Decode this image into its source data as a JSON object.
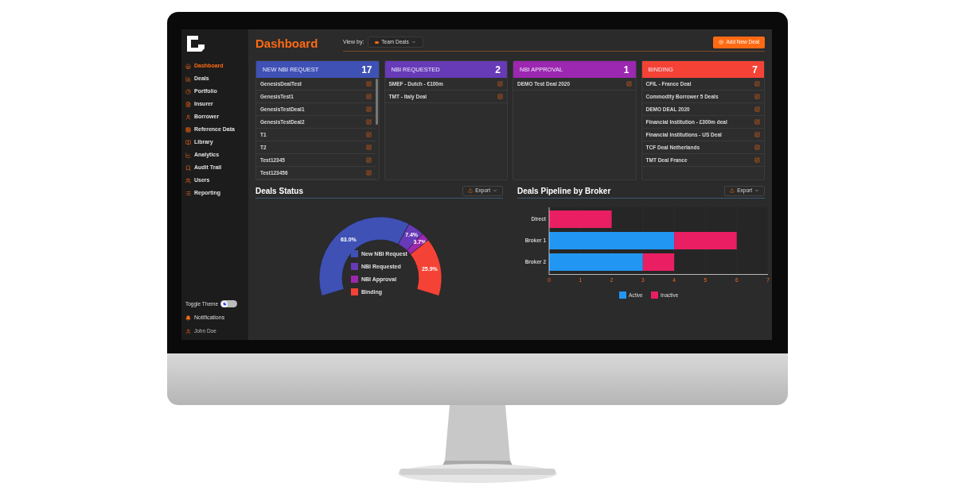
{
  "sidebar": {
    "items": [
      {
        "label": "Dashboard",
        "selected": true
      },
      {
        "label": "Deals",
        "selected": false
      },
      {
        "label": "Portfolio",
        "selected": false
      },
      {
        "label": "Insurer",
        "selected": false
      },
      {
        "label": "Borrower",
        "selected": false
      },
      {
        "label": "Reference Data",
        "selected": false
      },
      {
        "label": "Library",
        "selected": false
      },
      {
        "label": "Analytics",
        "selected": false
      },
      {
        "label": "Audit Trail",
        "selected": false
      },
      {
        "label": "Users",
        "selected": false
      },
      {
        "label": "Reporting",
        "selected": false
      }
    ],
    "toggle": {
      "label": "Toggle Theme",
      "on": false
    },
    "notifications": "Notifications",
    "user": "John Doe"
  },
  "header": {
    "title": "Dashboard",
    "view_by_label": "View by:",
    "view_by_value": "Team Deals",
    "add_button": "Add New Deal"
  },
  "columns": [
    {
      "title": "NEW NBI REQUEST",
      "count": "17",
      "color": "#3f51b5",
      "deals": [
        "GenesisDealTest",
        "GenesisTest1",
        "GenesisTestDeal1",
        "GenesisTestDeal2",
        "T1",
        "T2",
        "Test12345",
        "Test123456"
      ]
    },
    {
      "title": "NBI REQUESTED",
      "count": "2",
      "color": "#673ab7",
      "deals": [
        "SMEF - Dutch - €100m",
        "TMT - Italy Deal"
      ]
    },
    {
      "title": "NBI APPROVAL",
      "count": "1",
      "color": "#9c27b0",
      "deals": [
        "DEMO Test Deal 2020"
      ]
    },
    {
      "title": "BINDING",
      "count": "7",
      "color": "#f44336",
      "deals": [
        "CFIL - France Deal",
        "Commodity Borrower 5 Deals",
        "DEMO DEAL 2020",
        "Financial Institution - £300m deal",
        "Financial Institutions - US Deal",
        "TCF Deal Netherlands",
        "TMT Deal France"
      ]
    }
  ],
  "deals_status": {
    "title": "Deals Status",
    "export": "Export",
    "chart_data": {
      "type": "donut",
      "categories": [
        "New NBI Request",
        "NBI Requested",
        "NBI Approval",
        "Binding"
      ],
      "values": [
        63.0,
        7.4,
        3.7,
        25.9
      ],
      "colors": [
        "#3f51b5",
        "#673ab7",
        "#9c27b0",
        "#f44336"
      ],
      "value_labels": [
        "63.0%",
        "7.4%",
        "3.7%",
        "25.9%"
      ],
      "legend": "center"
    }
  },
  "pipeline": {
    "title": "Deals Pipeline by Broker",
    "export": "Export",
    "chart_data": {
      "type": "bar",
      "orientation": "horizontal",
      "stacked": true,
      "legend": "bottom",
      "categories": [
        "Direct",
        "Broker 1",
        "Broker 2"
      ],
      "series": [
        {
          "name": "Active",
          "color": "#2196f3",
          "values": [
            0,
            4,
            3
          ]
        },
        {
          "name": "Inactive",
          "color": "#e91e63",
          "values": [
            2,
            2,
            1
          ]
        }
      ],
      "xlim": [
        0,
        7
      ],
      "xticks": [
        0,
        1,
        2,
        3,
        4,
        5,
        6,
        7
      ]
    }
  }
}
